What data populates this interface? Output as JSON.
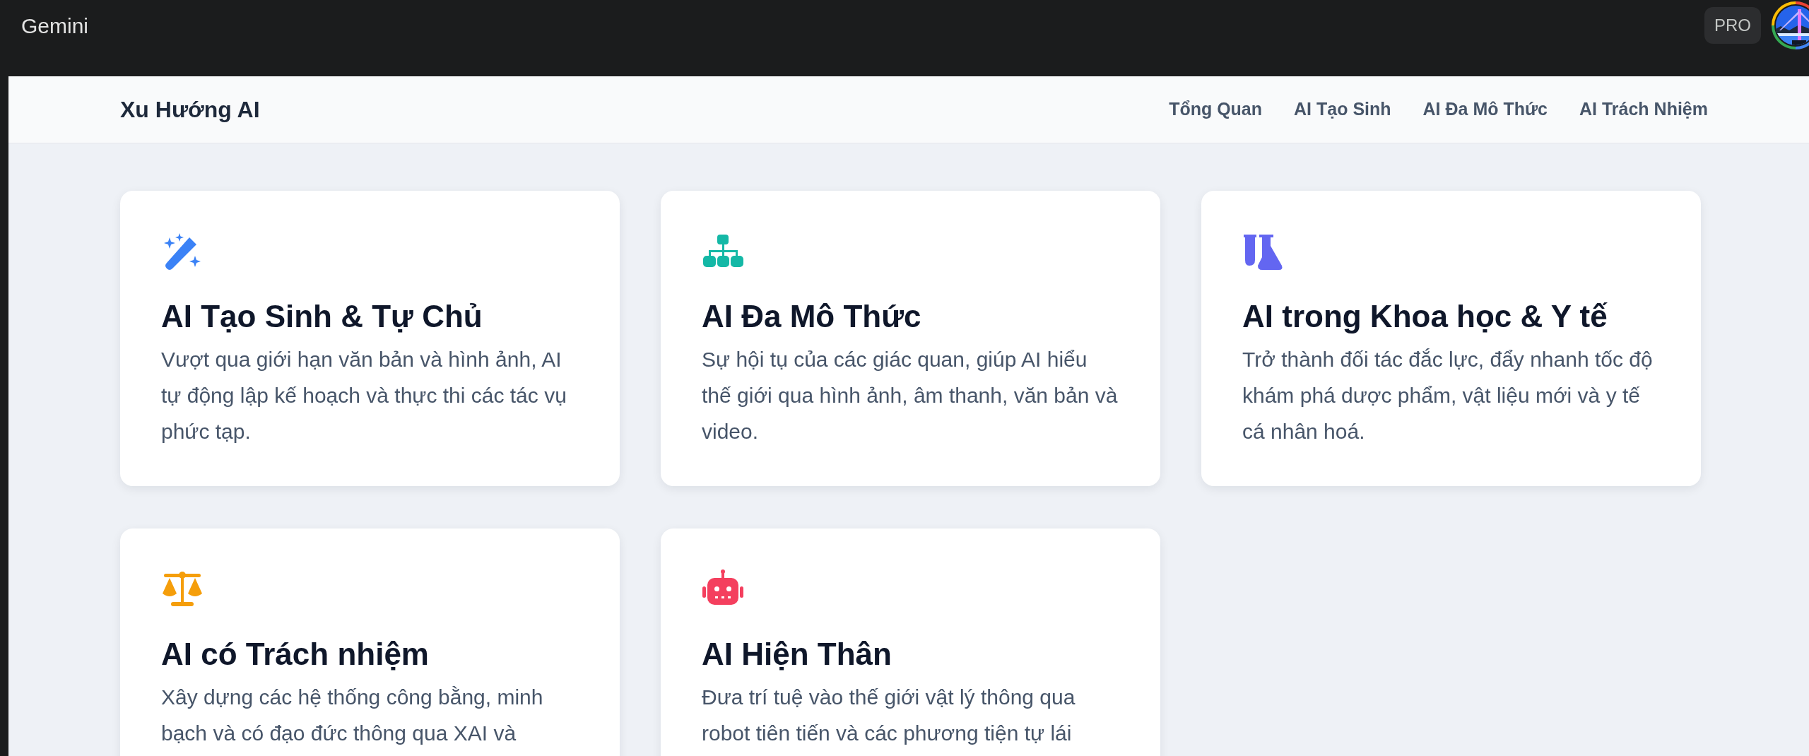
{
  "app_bar": {
    "title": "Gemini",
    "badge": "PRO"
  },
  "site_header": {
    "brand": "Xu Hướng AI",
    "nav": [
      "Tổng Quan",
      "AI Tạo Sinh",
      "AI Đa Mô Thức",
      "AI Trách Nhiệm"
    ]
  },
  "cards": [
    {
      "title": "AI Tạo Sinh & Tự Chủ",
      "description": "Vượt qua giới hạn văn bản và hình ảnh, AI tự động lập kế hoạch và thực thi các tác vụ phức tạp.",
      "color": "#3b82f6"
    },
    {
      "title": "AI Đa Mô Thức",
      "description": "Sự hội tụ của các giác quan, giúp AI hiểu thế giới qua hình ảnh, âm thanh, văn bản và video.",
      "color": "#14b8a6"
    },
    {
      "title": "AI trong Khoa học & Y tế",
      "description": "Trở thành đối tác đắc lực, đẩy nhanh tốc độ khám phá dược phẩm, vật liệu mới và y tế cá nhân hoá.",
      "color": "#6366f1"
    },
    {
      "title": "AI có Trách nhiệm",
      "description": "Xây dựng các hệ thống công bằng, minh bạch và có đạo đức thông qua XAI và",
      "color": "#f59e0b"
    },
    {
      "title": "AI Hiện Thân",
      "description": "Đưa trí tuệ vào thế giới vật lý thông qua robot tiên tiến và các phương tiện tự lái",
      "color": "#f43f5e"
    }
  ]
}
